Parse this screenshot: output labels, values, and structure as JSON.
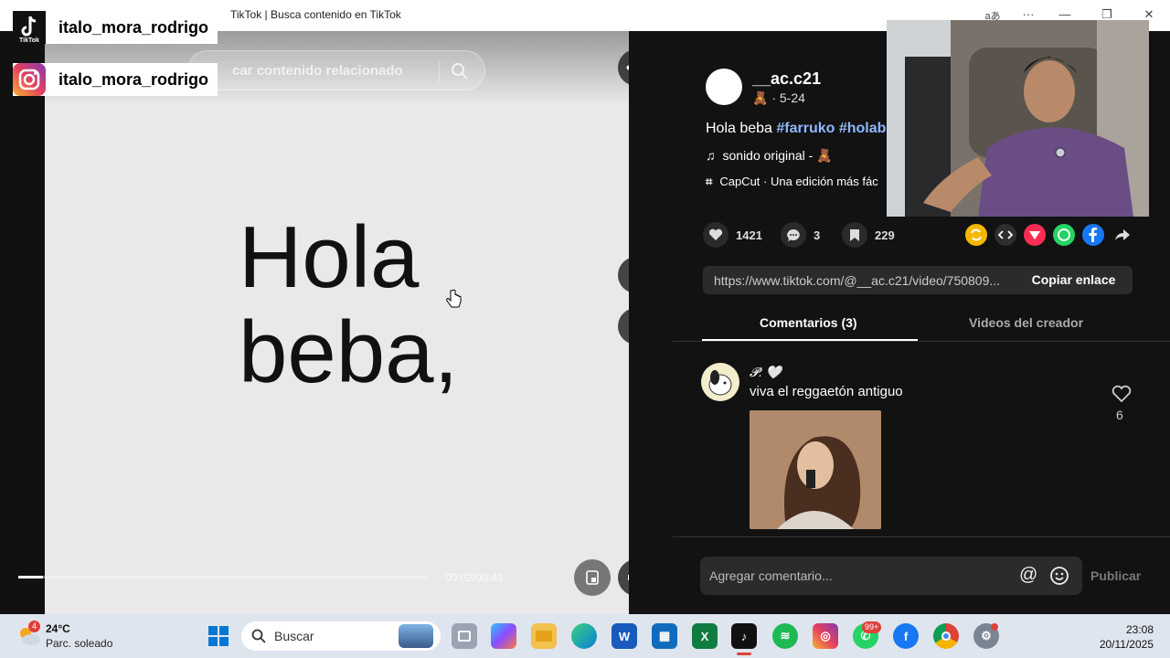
{
  "window": {
    "title": "TikTok | Busca contenido en TikTok",
    "lang_glyph": "aあ",
    "more_label": "···"
  },
  "overlays": {
    "tiktok_handle": "italo_mora_rodrigo",
    "tiktok_logo_label": "TikTok",
    "instagram_handle": "italo_mora_rodrigo"
  },
  "player": {
    "search_placeholder": "Buscar contenido relacionado",
    "search_placeholder_visible": "car contenido relacionado",
    "video_text_line1": "Hola",
    "video_text_line2": "beba,",
    "timecode": "00:02/00:43",
    "progress": 0.06
  },
  "post": {
    "username": "__ac.c21",
    "meta": "🧸 · 5-24",
    "description_plain": "Hola beba ",
    "hashtags": "#farruko #holab",
    "sound": "sonido original - 🧸",
    "capcut": "CapCut · Una edición más fác",
    "likes": "1421",
    "comments": "3",
    "saves": "229",
    "link": "https://www.tiktok.com/@__ac.c21/video/750809...",
    "copy_link": "Copiar enlace"
  },
  "tabs": {
    "comments": "Comentarios (3)",
    "creator_videos": "Videos del creador"
  },
  "comment": {
    "author": "𝓟. 🤍",
    "text": "viva el reggaetón antiguo",
    "likes": "6"
  },
  "composer": {
    "placeholder": "Agregar comentario...",
    "at": "@",
    "publish": "Publicar"
  },
  "taskbar": {
    "weather_temp": "24°C",
    "weather_desc": "Parc. soleado",
    "weather_badge": "4",
    "search": "Buscar",
    "whatsapp_badge": "99+",
    "time": "23:08",
    "date": "20/11/2025"
  },
  "colors": {
    "panel_bg": "#121212",
    "hashtag": "#8fb8ff",
    "taskbar": "#dfe5ee"
  }
}
